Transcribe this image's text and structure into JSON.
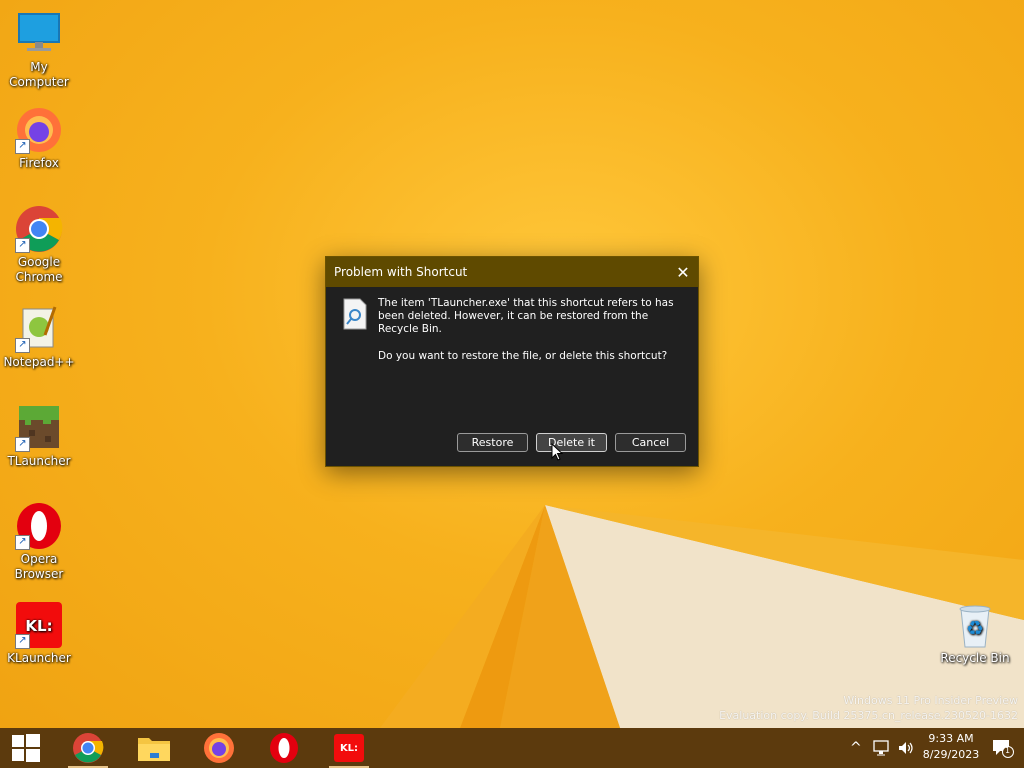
{
  "desktop": {
    "icons": [
      {
        "label": "My Computer",
        "icon": "monitor-icon"
      },
      {
        "label": "Firefox",
        "icon": "firefox-icon"
      },
      {
        "label": "Google Chrome",
        "icon": "chrome-icon"
      },
      {
        "label": "Notepad++",
        "icon": "notepadpp-icon"
      },
      {
        "label": "TLauncher",
        "icon": "tlauncher-icon"
      },
      {
        "label": "Opera Browser",
        "icon": "opera-icon"
      },
      {
        "label": "KLauncher",
        "icon": "klauncher-icon"
      },
      {
        "label": "Recycle Bin",
        "icon": "recycle-bin-icon"
      }
    ],
    "watermark": {
      "line1": "Windows 11 Pro Insider Preview",
      "line2": "Evaluation copy. Build 25375.cn_release.230520-1632"
    }
  },
  "dialog": {
    "title": "Problem with Shortcut",
    "close_glyph": "✕",
    "message1": "The item 'TLauncher.exe' that this shortcut refers to has been deleted. However, it can be restored from the Recycle Bin.",
    "message2": "Do you want to restore the file, or delete this shortcut?",
    "buttons": {
      "restore": "Restore",
      "delete": "Delete it",
      "cancel": "Cancel"
    }
  },
  "taskbar": {
    "apps": [
      "chrome",
      "file-explorer",
      "firefox",
      "opera",
      "klauncher"
    ],
    "klauncher_text": "KL:",
    "tray": {
      "chevron": "^",
      "time": "9:33 AM",
      "date": "8/29/2023",
      "notification_count": "1"
    }
  },
  "colors": {
    "wallpaper": "#f7b21c",
    "dialog_title": "#5f4a00",
    "dialog_body": "#202020",
    "taskbar": "#5c3a0d"
  }
}
